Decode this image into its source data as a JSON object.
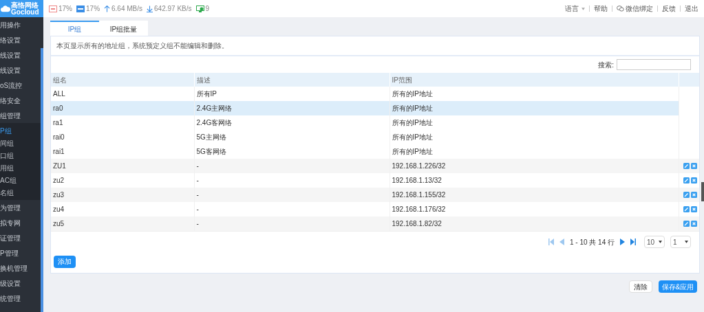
{
  "logo": {
    "name": "高恪网络",
    "brand": "Gocloud"
  },
  "status": [
    {
      "kind": "cpu",
      "value": "17%"
    },
    {
      "kind": "ram",
      "value": "17%"
    },
    {
      "kind": "up",
      "value": "6.64 MB/s"
    },
    {
      "kind": "down",
      "value": "642.97 KB/s"
    },
    {
      "kind": "clients",
      "value": "9"
    }
  ],
  "top_menu": [
    {
      "label": "语言",
      "kind": "dropdown"
    },
    {
      "label": "帮助",
      "kind": "link"
    },
    {
      "label": "微信绑定",
      "kind": "wechat"
    },
    {
      "label": "反馈",
      "kind": "link"
    },
    {
      "label": "退出",
      "kind": "link"
    }
  ],
  "sidebar": {
    "items": [
      {
        "label": "用操作"
      },
      {
        "label": "络设置"
      },
      {
        "label": "线设置"
      },
      {
        "label": "线设置"
      },
      {
        "label": "oS流控"
      },
      {
        "label": "络安全"
      },
      {
        "label": "组管理",
        "children": [
          {
            "label": "P组",
            "selected": true
          },
          {
            "label": "间组",
            "selected": false
          },
          {
            "label": "口组",
            "selected": false
          },
          {
            "label": "用组",
            "selected": false
          },
          {
            "label": "AC组",
            "selected": false
          },
          {
            "label": "名组",
            "selected": false
          }
        ]
      },
      {
        "label": "为管理"
      },
      {
        "label": "拟专网"
      },
      {
        "label": "证管理"
      },
      {
        "label": "P管理"
      },
      {
        "label": "换机管理"
      },
      {
        "label": "级设置"
      },
      {
        "label": "统管理"
      }
    ]
  },
  "tabs": [
    {
      "label": "IP组",
      "selected": true
    },
    {
      "label": "IP组批量",
      "selected": false
    }
  ],
  "notice": "本页显示所有的地址组，系统预定义组不能编辑和删除。",
  "search": {
    "label": "搜索:"
  },
  "table": {
    "columns": [
      "组名",
      "描述",
      "IP范围"
    ],
    "rows": [
      {
        "cells": [
          "ALL",
          "所有IP",
          "所有的IP地址"
        ],
        "editable": false,
        "selected": false
      },
      {
        "cells": [
          "ra0",
          "2.4G主网络",
          "所有的IP地址"
        ],
        "editable": false,
        "selected": true
      },
      {
        "cells": [
          "ra1",
          "2.4G客网络",
          "所有的IP地址"
        ],
        "editable": false,
        "selected": false
      },
      {
        "cells": [
          "rai0",
          "5G主网络",
          "所有的IP地址"
        ],
        "editable": false,
        "selected": false
      },
      {
        "cells": [
          "rai1",
          "5G客网络",
          "所有的IP地址"
        ],
        "editable": false,
        "selected": false
      },
      {
        "cells": [
          "ZU1",
          "-",
          "192.168.1.226/32"
        ],
        "editable": true,
        "selected": false
      },
      {
        "cells": [
          "zu2",
          "-",
          "192.168.1.13/32"
        ],
        "editable": true,
        "selected": false
      },
      {
        "cells": [
          "zu3",
          "-",
          "192.168.1.155/32"
        ],
        "editable": true,
        "selected": false
      },
      {
        "cells": [
          "zu4",
          "-",
          "192.168.1.176/32"
        ],
        "editable": true,
        "selected": false
      },
      {
        "cells": [
          "zu5",
          "-",
          "192.168.1.82/32"
        ],
        "editable": true,
        "selected": false
      }
    ]
  },
  "pagination": {
    "range": "1 - 10 共 14 行",
    "page_size": "10",
    "page": "1"
  },
  "add_button": "添加",
  "footer_buttons": [
    {
      "label": "清除",
      "kind": "secondary"
    },
    {
      "label": "保存&应用",
      "kind": "primary"
    }
  ]
}
